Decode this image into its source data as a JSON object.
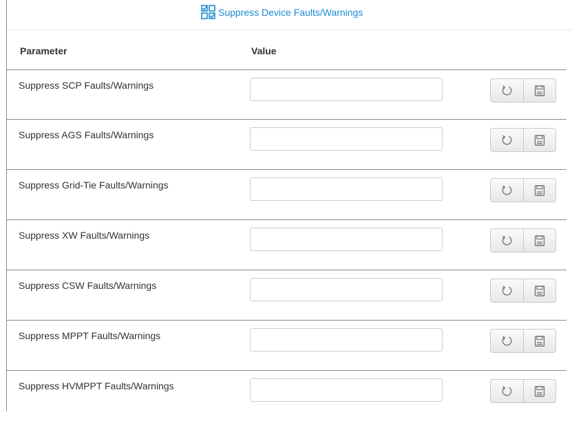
{
  "header": {
    "title": "Suppress Device Faults/Warnings",
    "title_icon": "checklist-icon",
    "accent_color": "#1c8ad1"
  },
  "table": {
    "columns": {
      "parameter": "Parameter",
      "value": "Value"
    },
    "rows": [
      {
        "label": "Suppress SCP Faults/Warnings",
        "value": ""
      },
      {
        "label": "Suppress AGS Faults/Warnings",
        "value": ""
      },
      {
        "label": "Suppress Grid-Tie Faults/Warnings",
        "value": ""
      },
      {
        "label": "Suppress XW Faults/Warnings",
        "value": ""
      },
      {
        "label": "Suppress CSW Faults/Warnings",
        "value": ""
      },
      {
        "label": "Suppress MPPT Faults/Warnings",
        "value": ""
      },
      {
        "label": "Suppress HVMPPT Faults/Warnings",
        "value": ""
      }
    ],
    "row_actions": [
      "refresh-icon",
      "save-icon"
    ]
  }
}
